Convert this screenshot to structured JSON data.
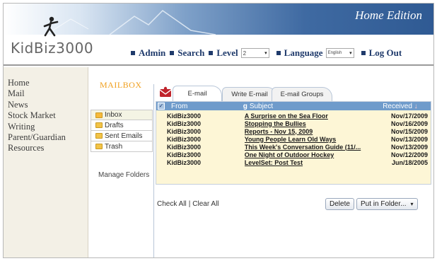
{
  "header": {
    "edition": "Home Edition",
    "logo_text": "KidBiz3000",
    "colors": {
      "banner_dark": "#2f5a93",
      "banner_light": "#a8c2e0",
      "nav_text": "#1f3a6b",
      "mailbox_title": "#f0a020"
    }
  },
  "nav": {
    "admin": "Admin",
    "search": "Search",
    "level": "Level",
    "level_value": "2",
    "language": "Language",
    "language_value": "English",
    "logout": "Log Out"
  },
  "leftnav": {
    "items": [
      {
        "label": "Home"
      },
      {
        "label": "Mail"
      },
      {
        "label": "News"
      },
      {
        "label": "Stock Market"
      },
      {
        "label": "Writing"
      },
      {
        "label": "Parent/Guardian"
      },
      {
        "label": "Resources"
      }
    ]
  },
  "mailbox": {
    "title": "MAILBOX",
    "folders": [
      {
        "label": "Inbox",
        "icon": "open-folder-icon"
      },
      {
        "label": "Drafts",
        "icon": "folder-icon"
      },
      {
        "label": "Sent Emails",
        "icon": "folder-icon"
      },
      {
        "label": "Trash",
        "icon": "folder-icon"
      }
    ],
    "manage": "Manage Folders"
  },
  "tabs": [
    {
      "label": "E-mail"
    },
    {
      "label": "Write E-mail"
    },
    {
      "label": "E-mail Groups"
    }
  ],
  "table": {
    "headers": {
      "from": "From",
      "subject": "Subject",
      "received": "Received"
    },
    "rows": [
      {
        "from": "KidBiz3000",
        "subject": "A Surprise on the Sea Floor",
        "received": "Nov/17/2009"
      },
      {
        "from": "KidBiz3000",
        "subject": "Stopping the Bullies",
        "received": "Nov/16/2009"
      },
      {
        "from": "KidBiz3000",
        "subject": "Reports - Nov 15, 2009",
        "received": "Nov/15/2009"
      },
      {
        "from": "KidBiz3000",
        "subject": "Young People Learn Old Ways",
        "received": "Nov/13/2009"
      },
      {
        "from": "KidBiz3000",
        "subject": "This Week's Conversation Guide (11/...",
        "received": "Nov/13/2009"
      },
      {
        "from": "KidBiz3000",
        "subject": "One Night of Outdoor Hockey",
        "received": "Nov/12/2009"
      },
      {
        "from": "KidBiz3000",
        "subject": "LevelSet: Post Test",
        "received": "Jun/18/2005"
      }
    ]
  },
  "actions": {
    "check_all": "Check All",
    "separator": "|",
    "clear_all": "Clear All",
    "delete": "Delete",
    "put_in_folder": "Put in Folder..."
  }
}
